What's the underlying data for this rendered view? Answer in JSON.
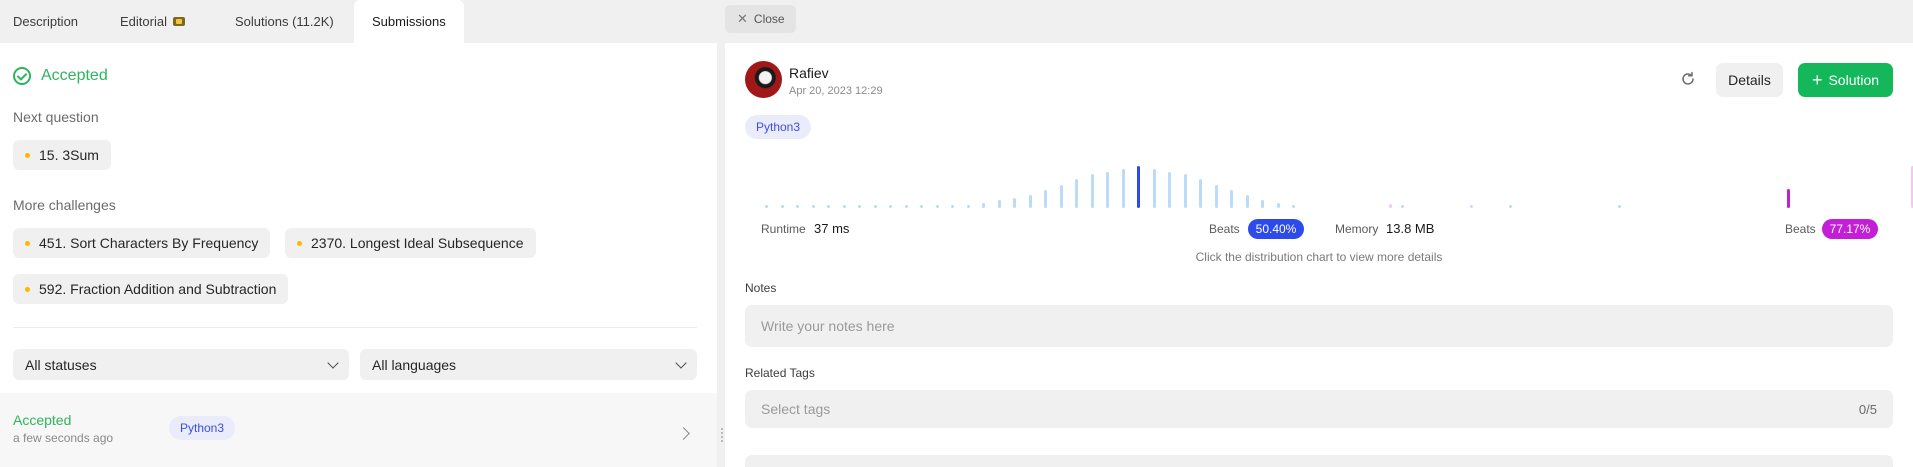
{
  "tabs": [
    {
      "label": "Description"
    },
    {
      "label": "Editorial"
    },
    {
      "label": "Solutions (11.2K)"
    },
    {
      "label": "Submissions"
    }
  ],
  "result": {
    "status": "Accepted"
  },
  "next_question": {
    "label": "Next question",
    "item": "15. 3Sum"
  },
  "more_challenges": {
    "label": "More challenges",
    "items": [
      "451. Sort Characters By Frequency",
      "2370. Longest Ideal Subsequence",
      "592. Fraction Addition and Subtraction"
    ]
  },
  "filters": {
    "status": "All statuses",
    "language": "All languages"
  },
  "submission_row": {
    "status": "Accepted",
    "time": "a few seconds ago",
    "language": "Python3"
  },
  "close_label": "Close",
  "user": {
    "name": "Rafiev",
    "date": "Apr 20, 2023 12:29"
  },
  "actions": {
    "details": "Details",
    "solution": "Solution"
  },
  "language": "Python3",
  "runtime": {
    "label": "Runtime",
    "value": "37 ms",
    "beats_label": "Beats",
    "beats": "50.40%",
    "beats_color": "#2c4bea"
  },
  "memory": {
    "label": "Memory",
    "value": "13.8 MB",
    "beats_label": "Beats",
    "beats": "77.17%",
    "beats_color": "#c21fd6"
  },
  "hint": "Click the distribution chart to view more details",
  "notes": {
    "label": "Notes",
    "placeholder": "Write your notes here"
  },
  "tags": {
    "label": "Related Tags",
    "placeholder": "Select tags",
    "count": "0/5"
  },
  "chart_data": [
    {
      "type": "bar",
      "series": [
        {
          "values": [
            1,
            1,
            1,
            1,
            1,
            1,
            1,
            1,
            1,
            1,
            1,
            1,
            1,
            1,
            2,
            3,
            4,
            5,
            7,
            9,
            11,
            13,
            14,
            15,
            16,
            15,
            14,
            13,
            11,
            9,
            7,
            5,
            3,
            2,
            1,
            0,
            0,
            0,
            0,
            0,
            0,
            1,
            0,
            0,
            0,
            0,
            0,
            0,
            1,
            0,
            0,
            0,
            0,
            0,
            0,
            1
          ]
        }
      ],
      "highlight_index": 24,
      "colors": {
        "bar": "#bcdbf7",
        "highlight": "#2c4bea"
      }
    },
    {
      "type": "bar",
      "series": [
        {
          "values": [
            2,
            0,
            0,
            0,
            0,
            0,
            0,
            0,
            0,
            0,
            0,
            0,
            0,
            0,
            0,
            1,
            0,
            0,
            0,
            0,
            0,
            0,
            0,
            0,
            0,
            0,
            0,
            0,
            0,
            0,
            0,
            0,
            0,
            0,
            0,
            0,
            0,
            0,
            0,
            0,
            0,
            0,
            0,
            0,
            0,
            0,
            0,
            0,
            0,
            0,
            0,
            0,
            0,
            0,
            0,
            0,
            0,
            0,
            0,
            0,
            0,
            0,
            0,
            0,
            0,
            0,
            0,
            0,
            0,
            0,
            0,
            0,
            0,
            0,
            9,
            0,
            0,
            0,
            0,
            0,
            0,
            0,
            0,
            0,
            0,
            0,
            0,
            0,
            0,
            0,
            0,
            0,
            0,
            0,
            0,
            0,
            0,
            20
          ]
        }
      ],
      "highlight_index": 74,
      "colors": {
        "bar": "#f4c7f2",
        "highlight": "#c21fd6"
      }
    }
  ]
}
